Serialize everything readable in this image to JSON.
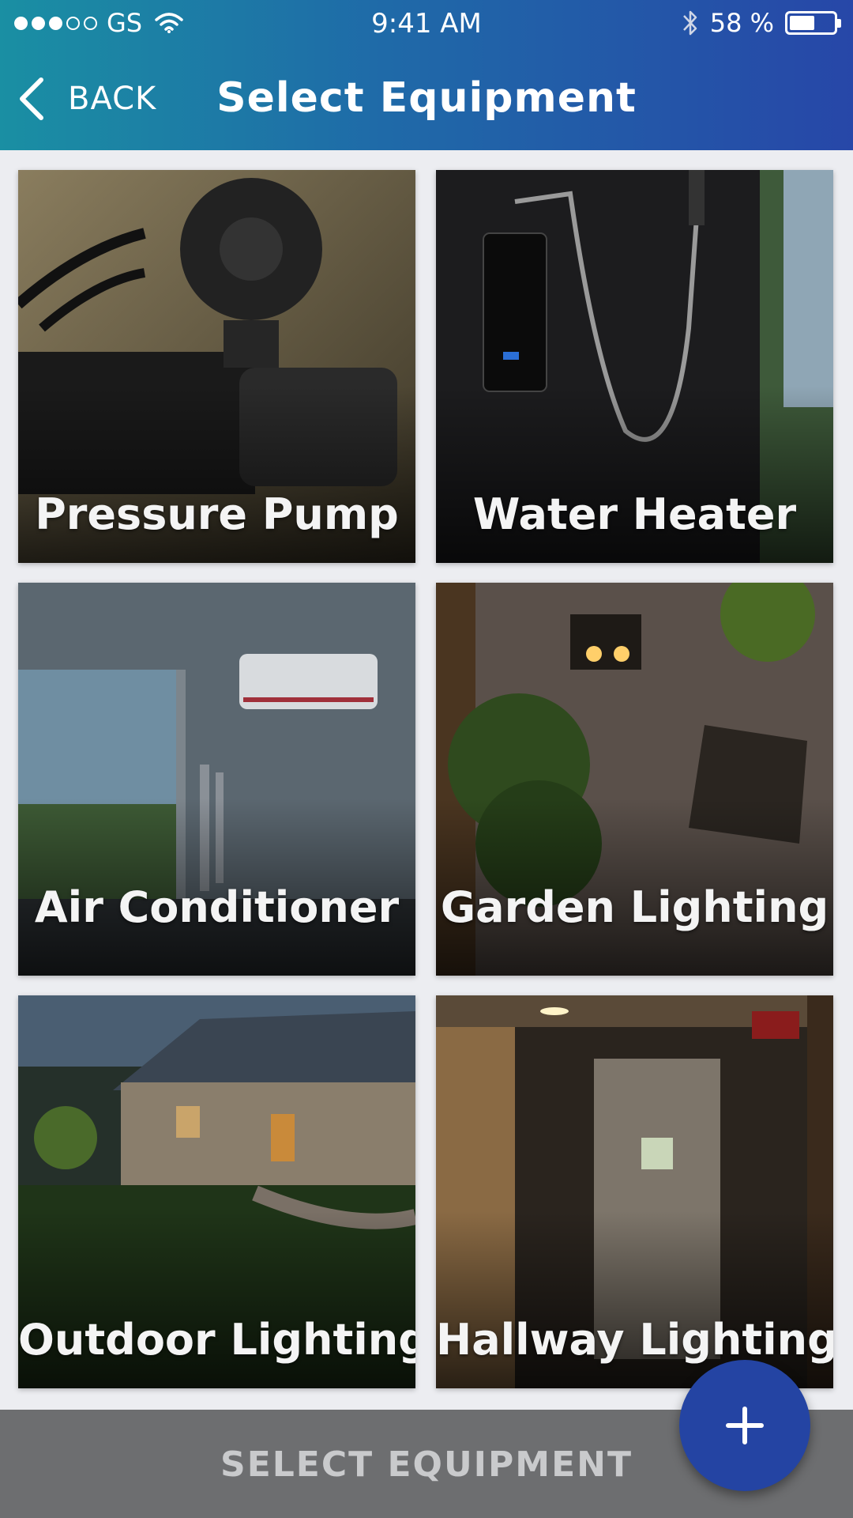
{
  "status_bar": {
    "carrier": "GS",
    "time": "9:41 AM",
    "battery_percent": "58 %",
    "battery_level": 0.58,
    "signal_bars_filled": 3,
    "signal_bars_total": 5,
    "icons": [
      "wifi-icon",
      "bluetooth-icon",
      "battery-icon"
    ]
  },
  "nav": {
    "back_label": "BACK",
    "title": "Select  Equipment"
  },
  "tiles": [
    {
      "label": "Pressure Pump",
      "image": "pressure-pump-photo"
    },
    {
      "label": "Water Heater",
      "image": "water-heater-photo"
    },
    {
      "label": "Air Conditioner",
      "image": "air-conditioner-photo"
    },
    {
      "label": "Garden Lighting",
      "image": "garden-lighting-photo"
    },
    {
      "label": "Outdoor Lighting",
      "image": "outdoor-lighting-photo"
    },
    {
      "label": "Hallway Lighting",
      "image": "hallway-lighting-photo"
    }
  ],
  "bottom_bar": {
    "label": "SELECT  EQUIPMENT"
  },
  "fab": {
    "icon": "plus-icon"
  },
  "colors": {
    "header_start": "#1a8fa3",
    "header_end": "#2747a8",
    "bottom_bar": "#6d6e70",
    "fab": "#2444a3",
    "background": "#ecedf1"
  }
}
